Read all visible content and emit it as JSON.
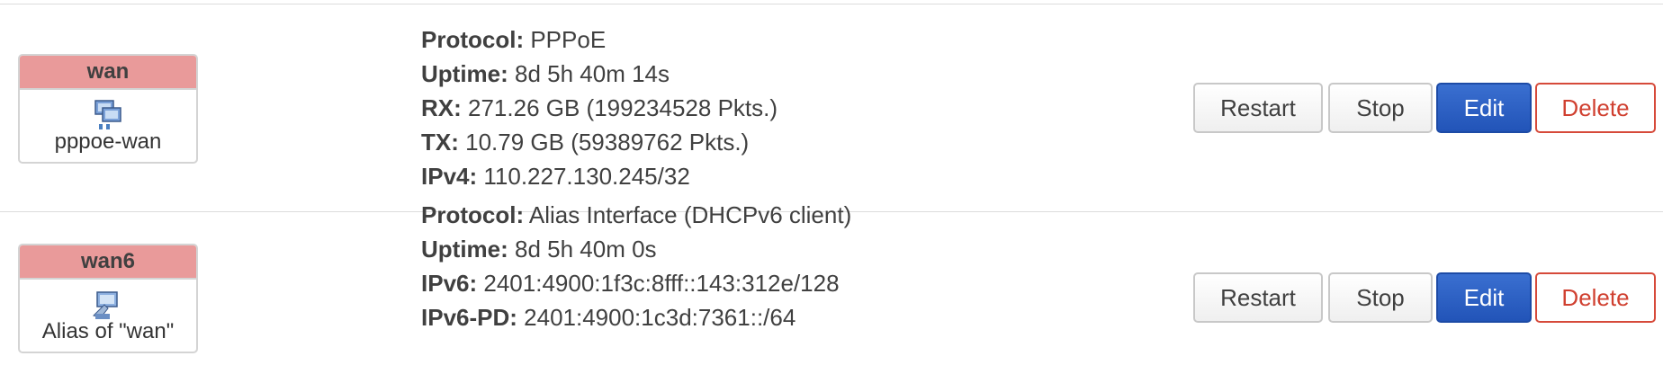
{
  "interfaces": [
    {
      "name": "wan",
      "device": "pppoe-wan",
      "icon": "network-ethernet-icon",
      "status": [
        {
          "key": "Protocol:",
          "value": " PPPoE"
        },
        {
          "key": "Uptime:",
          "value": " 8d 5h 40m 14s"
        },
        {
          "key": "RX:",
          "value": " 271.26 GB (199234528 Pkts.)"
        },
        {
          "key": "TX:",
          "value": " 10.79 GB (59389762 Pkts.)"
        },
        {
          "key": "IPv4:",
          "value": " 110.227.130.245/32"
        }
      ],
      "actions": {
        "restart": "Restart",
        "stop": "Stop",
        "edit": "Edit",
        "delete": "Delete"
      }
    },
    {
      "name": "wan6",
      "device": "Alias of \"wan\"",
      "icon": "alias-interface-icon",
      "status": [
        {
          "key": "Protocol:",
          "value": " Alias Interface (DHCPv6 client)"
        },
        {
          "key": "Uptime:",
          "value": " 8d 5h 40m 0s"
        },
        {
          "key": "IPv6:",
          "value": " 2401:4900:1f3c:8fff::143:312e/128"
        },
        {
          "key": "IPv6-PD:",
          "value": " 2401:4900:1c3d:7361::/64"
        }
      ],
      "actions": {
        "restart": "Restart",
        "stop": "Stop",
        "edit": "Edit",
        "delete": "Delete"
      }
    }
  ],
  "colors": {
    "zone_wan": "#e99a9a",
    "edit_button": "#2254b8",
    "delete_text": "#d04030"
  }
}
